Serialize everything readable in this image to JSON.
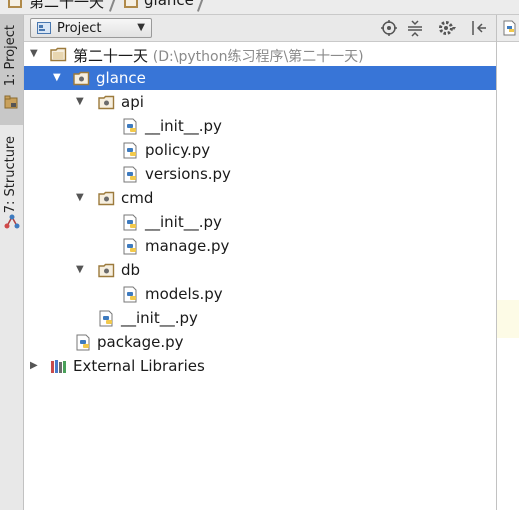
{
  "breadcrumb": {
    "root": "第二十一天",
    "child": "glance"
  },
  "tool_strip": {
    "project_label": "1: Project",
    "structure_label": "7: Structure"
  },
  "toolbar": {
    "view_select": "Project"
  },
  "tree": [
    {
      "name": "第二十一天",
      "hint": "(D:\\python练习程序\\第二十一天)",
      "kind": "folder",
      "expanded": true
    },
    {
      "name": "glance",
      "kind": "package",
      "expanded": true,
      "selected": true
    },
    {
      "name": "api",
      "kind": "package",
      "expanded": true
    },
    {
      "name": "__init__.py",
      "kind": "py"
    },
    {
      "name": "policy.py",
      "kind": "py"
    },
    {
      "name": "versions.py",
      "kind": "py"
    },
    {
      "name": "cmd",
      "kind": "package",
      "expanded": true
    },
    {
      "name": "__init__.py",
      "kind": "py"
    },
    {
      "name": "manage.py",
      "kind": "py"
    },
    {
      "name": "db",
      "kind": "package",
      "expanded": true
    },
    {
      "name": "models.py",
      "kind": "py"
    },
    {
      "name": "__init__.py",
      "kind": "py"
    },
    {
      "name": "package.py",
      "kind": "py"
    },
    {
      "name": "External Libraries",
      "kind": "library",
      "expanded": false
    }
  ],
  "colors": {
    "selection": "#3875d7",
    "folder": "#b08a4a",
    "python_blue": "#3e7bbf",
    "python_yellow": "#f2c94c"
  }
}
